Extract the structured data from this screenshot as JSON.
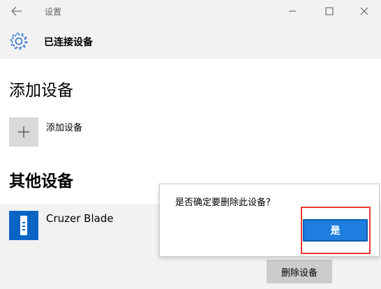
{
  "window": {
    "title": "设置",
    "icons": {
      "back": "back-arrow-icon",
      "minimize": "minimize-icon",
      "maximize": "maximize-icon",
      "close": "close-icon"
    }
  },
  "header": {
    "icon": "gear-icon",
    "title": "已连接设备"
  },
  "add_section": {
    "title": "添加设备",
    "tile_icon": "plus-icon",
    "label": "添加设备"
  },
  "other_section": {
    "title": "其他设备",
    "device": {
      "icon": "usb-drive-icon",
      "name": "Cruzer Blade",
      "remove_label": "删除设备"
    }
  },
  "dialog": {
    "message": "是否确定要删除此设备?",
    "yes_label": "是"
  },
  "colors": {
    "accent": "#1e7ee0",
    "device_icon_bg": "#0a64c6",
    "highlight": "#e53935"
  }
}
